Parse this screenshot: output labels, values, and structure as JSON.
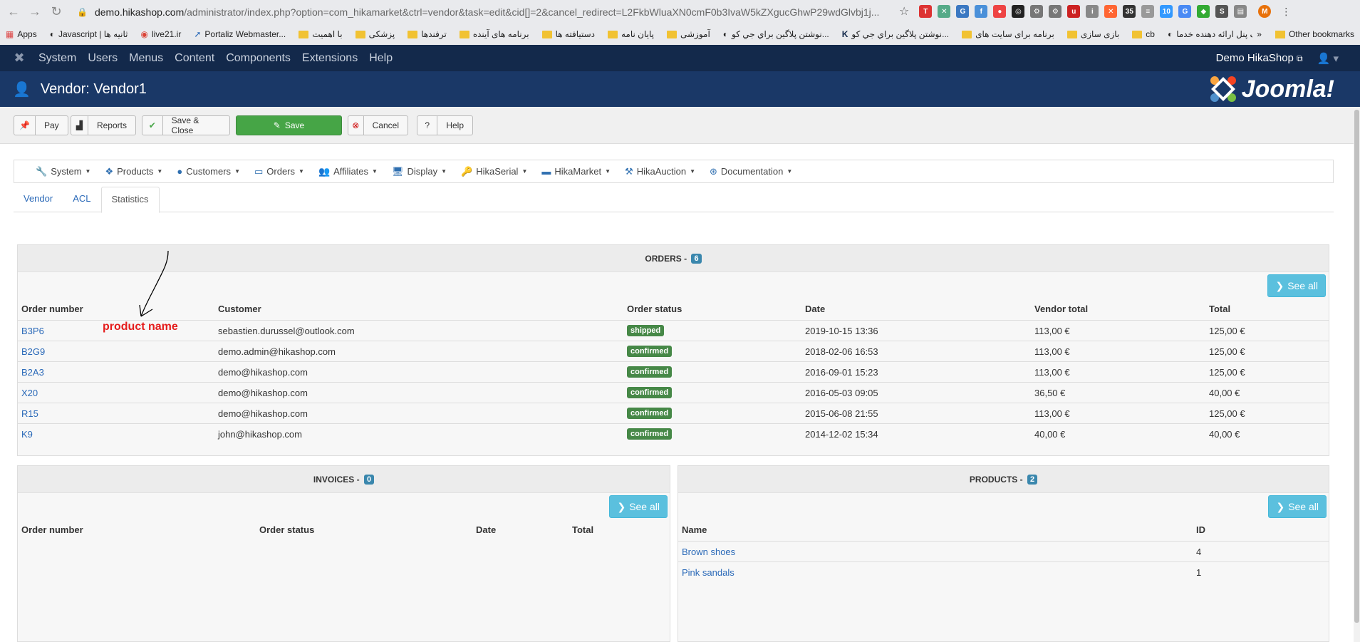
{
  "browser": {
    "url_host": "demo.hikashop.com",
    "url_path": "/administrator/index.php?option=com_hikamarket&ctrl=vendor&task=edit&cid[]=2&cancel_redirect=L2FkbWluaXN0cmF0b3IvaW5kZXgucGhwP29wdGlvbj1j...",
    "bookmarks": [
      "Apps",
      "Javascript | ثانیه ها",
      "live21.ir",
      "Portaliz Webmaster...",
      "با اهمیت",
      "پزشکی",
      "ترفندها",
      "برنامه های آینده",
      "دستیافته ها",
      "پایان نامه",
      "آموزشی",
      "نوشتن پلاگین براي جي كو...",
      "نوشتن پلاگین براي جي كو...",
      "برنامه برای سایت های",
      "بازی سازی",
      "cb",
      "پیامک پنل ارائه دهنده خدما..."
    ],
    "other_bookmarks": "Other bookmarks"
  },
  "topnav": {
    "items": [
      "System",
      "Users",
      "Menus",
      "Content",
      "Components",
      "Extensions",
      "Help"
    ],
    "site_link": "Demo HikaShop"
  },
  "header": {
    "title": "Vendor: Vendor1",
    "brand": "Joomla!"
  },
  "toolbar": {
    "pay": "Pay",
    "reports": "Reports",
    "save_close": "Save & Close",
    "save": "Save",
    "cancel": "Cancel",
    "help": "Help"
  },
  "hikamenu": [
    "System",
    "Products",
    "Customers",
    "Orders",
    "Affiliates",
    "Display",
    "HikaSerial",
    "HikaMarket",
    "HikaAuction",
    "Documentation"
  ],
  "tabs": [
    "Vendor",
    "ACL",
    "Statistics"
  ],
  "orders": {
    "title": "ORDERS -",
    "count": "6",
    "see_all": "See all",
    "columns": [
      "Order number",
      "Customer",
      "Order status",
      "Date",
      "Vendor total",
      "Total"
    ],
    "rows": [
      {
        "number": "B3P6",
        "customer": "sebastien.durussel@outlook.com",
        "status": "shipped",
        "date": "2019-10-15 13:36",
        "vendor_total": "113,00 €",
        "total": "125,00 €"
      },
      {
        "number": "B2G9",
        "customer": "demo.admin@hikashop.com",
        "status": "confirmed",
        "date": "2018-02-06 16:53",
        "vendor_total": "113,00 €",
        "total": "125,00 €"
      },
      {
        "number": "B2A3",
        "customer": "demo@hikashop.com",
        "status": "confirmed",
        "date": "2016-09-01 15:23",
        "vendor_total": "113,00 €",
        "total": "125,00 €"
      },
      {
        "number": "X20",
        "customer": "demo@hikashop.com",
        "status": "confirmed",
        "date": "2016-05-03 09:05",
        "vendor_total": "36,50 €",
        "total": "40,00 €"
      },
      {
        "number": "R15",
        "customer": "demo@hikashop.com",
        "status": "confirmed",
        "date": "2015-06-08 21:55",
        "vendor_total": "113,00 €",
        "total": "125,00 €"
      },
      {
        "number": "K9",
        "customer": "john@hikashop.com",
        "status": "confirmed",
        "date": "2014-12-02 15:34",
        "vendor_total": "40,00 €",
        "total": "40,00 €"
      }
    ]
  },
  "annotation": "product name",
  "invoices": {
    "title": "INVOICES -",
    "count": "0",
    "see_all": "See all",
    "columns": [
      "Order number",
      "Order status",
      "Date",
      "Total"
    ]
  },
  "products": {
    "title": "PRODUCTS -",
    "count": "2",
    "see_all": "See all",
    "columns": [
      "Name",
      "ID"
    ],
    "rows": [
      {
        "name": "Brown shoes",
        "id": "4"
      },
      {
        "name": "Pink sandals",
        "id": "1"
      }
    ]
  },
  "colors": {
    "nav_bg": "#13294b",
    "header_bg": "#1a3867",
    "save_green": "#46a546",
    "see_all_blue": "#5bc0de",
    "status_green": "#468847",
    "link_blue": "#2a69b8"
  }
}
